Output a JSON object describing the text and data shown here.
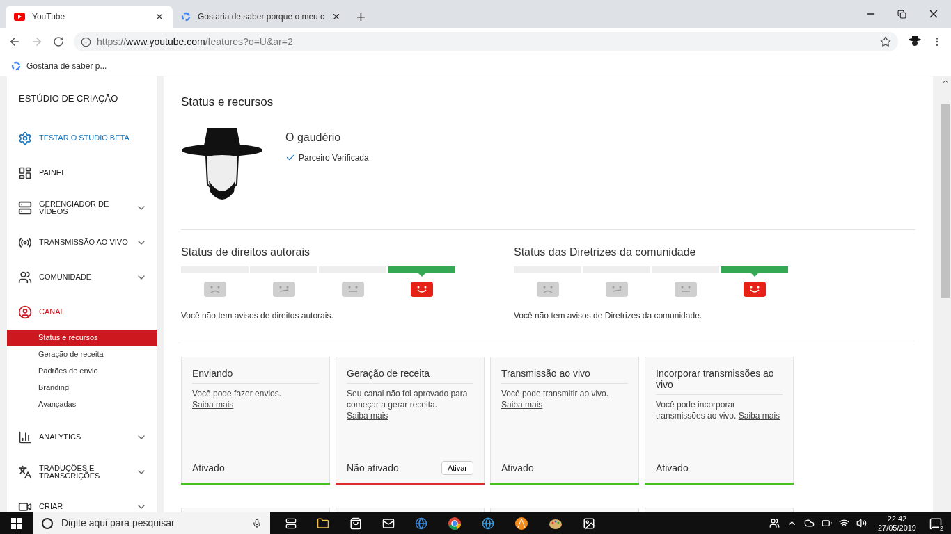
{
  "browser": {
    "tabs": [
      {
        "title": "YouTube",
        "selected": true
      },
      {
        "title": "Gostaria de saber porque o meu c",
        "selected": false
      }
    ],
    "new_tab": "+",
    "url_prefix": "https://",
    "url_host": "www.youtube.com",
    "url_path": "/features?o=U&ar=2",
    "bookmarks": [
      "Gostaria de saber p..."
    ]
  },
  "sidebar": {
    "title": "ESTÚDIO DE CRIAÇÃO",
    "items": [
      {
        "label": "TESTAR O STUDIO BETA",
        "kind": "promo",
        "expandable": false,
        "selected": false
      },
      {
        "label": "PAINEL",
        "kind": "nav",
        "expandable": false,
        "selected": false
      },
      {
        "label": "GERENCIADOR DE VÍDEOS",
        "kind": "nav",
        "expandable": true,
        "selected": false
      },
      {
        "label": "TRANSMISSÃO AO VIVO",
        "kind": "nav",
        "expandable": true,
        "selected": false
      },
      {
        "label": "COMUNIDADE",
        "kind": "nav",
        "expandable": true,
        "selected": false
      },
      {
        "label": "CANAL",
        "kind": "nav",
        "expandable": false,
        "selected": true,
        "children": [
          {
            "label": "Status e recursos",
            "selected": true
          },
          {
            "label": "Geração de receita",
            "selected": false
          },
          {
            "label": "Padrões de envio",
            "selected": false
          },
          {
            "label": "Branding",
            "selected": false
          },
          {
            "label": "Avançadas",
            "selected": false
          }
        ]
      },
      {
        "label": "ANALYTICS",
        "kind": "nav",
        "expandable": true,
        "selected": false
      },
      {
        "label": "TRADUÇÕES E TRANSCRIÇÕES",
        "kind": "nav",
        "expandable": true,
        "selected": false
      },
      {
        "label": "CRIAR",
        "kind": "nav",
        "expandable": true,
        "selected": false
      }
    ]
  },
  "page": {
    "title": "Status e recursos",
    "channel": {
      "name": "O gaudério",
      "badge": "Parceiro Verificada"
    },
    "statuses": [
      {
        "title": "Status de direitos autorais",
        "levels": [
          {
            "selected": false
          },
          {
            "selected": false
          },
          {
            "selected": false
          },
          {
            "selected": true
          }
        ],
        "message": "Você não tem avisos de direitos autorais."
      },
      {
        "title": "Status das Diretrizes da comunidade",
        "levels": [
          {
            "selected": false
          },
          {
            "selected": false
          },
          {
            "selected": false
          },
          {
            "selected": true
          }
        ],
        "message": "Você não tem avisos de Diretrizes da comunidade."
      }
    ],
    "cards": [
      {
        "title": "Enviando",
        "text": "Você pode fazer envios.",
        "link": "Saiba mais",
        "status": "Ativado",
        "on": true
      },
      {
        "title": "Geração de receita",
        "text": "Seu canal não foi aprovado para começar a gerar receita.",
        "link": "Saiba mais",
        "status": "Não ativado",
        "on": false,
        "button": "Ativar"
      },
      {
        "title": "Transmissão ao vivo",
        "text": "Você pode transmitir ao vivo.",
        "link": "Saiba mais",
        "status": "Ativado",
        "on": true
      },
      {
        "title": "Incorporar transmissões ao vivo",
        "text": "Você pode incorporar transmissões ao vivo.",
        "link": "Saiba mais",
        "status": "Ativado",
        "on": true
      }
    ]
  },
  "taskbar": {
    "search_placeholder": "Digite aqui para pesquisar",
    "time": "22:42",
    "date": "27/05/2019",
    "notifications": "2"
  }
}
